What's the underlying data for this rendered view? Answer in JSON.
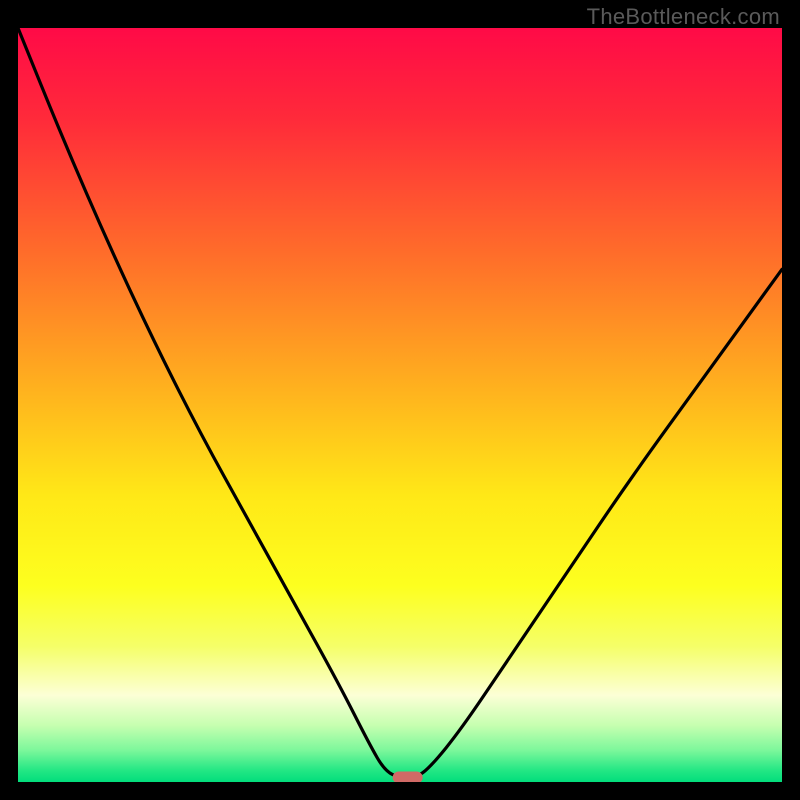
{
  "watermark": "TheBottleneck.com",
  "chart_data": {
    "type": "line",
    "title": "",
    "xlabel": "",
    "ylabel": "",
    "xlim": [
      0,
      100
    ],
    "ylim": [
      0,
      100
    ],
    "grid": false,
    "legend": false,
    "series": [
      {
        "name": "bottleneck-curve",
        "x": [
          0,
          6,
          12,
          18,
          24,
          30,
          36,
          42,
          46,
          48,
          50,
          52,
          54,
          58,
          64,
          72,
          80,
          90,
          100
        ],
        "y": [
          100,
          85,
          71,
          58,
          46,
          35,
          24,
          13,
          5,
          1.5,
          0.5,
          0.5,
          2,
          7,
          16,
          28,
          40,
          54,
          68
        ]
      }
    ],
    "annotations": [
      {
        "name": "min-marker",
        "type": "capsule",
        "x_center": 51,
        "y_center": 0.6,
        "color": "#d06a66"
      }
    ],
    "background_gradient": {
      "type": "vertical",
      "stops": [
        {
          "offset": 0.0,
          "color": "#ff0a47"
        },
        {
          "offset": 0.12,
          "color": "#ff2a3a"
        },
        {
          "offset": 0.3,
          "color": "#ff6d2a"
        },
        {
          "offset": 0.48,
          "color": "#ffb21e"
        },
        {
          "offset": 0.62,
          "color": "#ffe817"
        },
        {
          "offset": 0.74,
          "color": "#fdff1f"
        },
        {
          "offset": 0.82,
          "color": "#f5ff68"
        },
        {
          "offset": 0.885,
          "color": "#fcffd6"
        },
        {
          "offset": 0.925,
          "color": "#c6ffb0"
        },
        {
          "offset": 0.958,
          "color": "#7cf79b"
        },
        {
          "offset": 0.985,
          "color": "#22e784"
        },
        {
          "offset": 1.0,
          "color": "#02dd7c"
        }
      ]
    }
  }
}
